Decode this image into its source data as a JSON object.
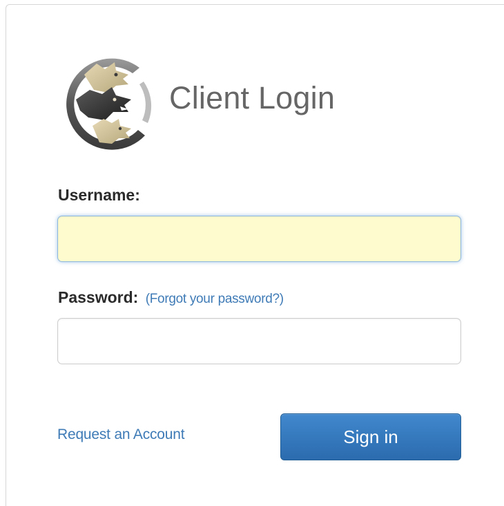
{
  "header": {
    "title": "Client Login",
    "logo_icon": "three-headed-wolf-logo-icon"
  },
  "form": {
    "username_label": "Username:",
    "username_value": "",
    "username_placeholder": "",
    "password_label": "Password:",
    "password_value": "",
    "password_placeholder": "",
    "forgot_link": "(Forgot your password?)",
    "request_account_link": "Request an Account",
    "sign_in_label": "Sign in"
  },
  "colors": {
    "link": "#3f7bb6",
    "button": "#2f72b6",
    "username_field_bg": "#fefbcf",
    "title": "#666666"
  }
}
